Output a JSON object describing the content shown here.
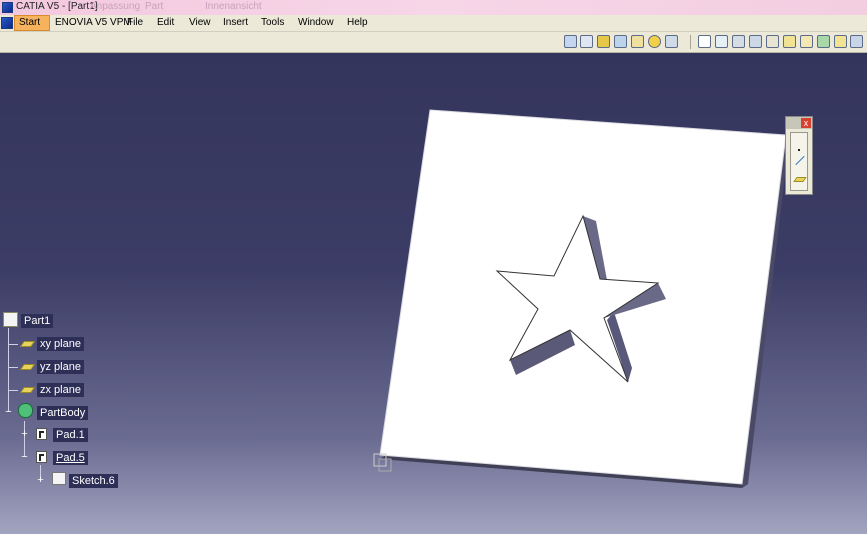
{
  "window": {
    "title": "CATIA V5 - [Part1]",
    "ghost_texts": [
      "Anpassung",
      "Part",
      "Innenansicht"
    ]
  },
  "menubar": {
    "start": "Start",
    "items": [
      "ENOVIA V5 VPM",
      "File",
      "Edit",
      "View",
      "Insert",
      "Tools",
      "Window",
      "Help"
    ]
  },
  "toolbar": {
    "icons": [
      "view-icon",
      "box-icon",
      "cube-icon",
      "rotate-icon",
      "pan-icon",
      "compass-icon",
      "zoom-icon",
      "sketch-tool-icon",
      "pad-tool-icon",
      "pocket-tool-icon",
      "shaft-tool-icon",
      "hole-tool-icon",
      "fillet-tool-icon",
      "chamfer-tool-icon",
      "draft-tool-icon",
      "shell-tool-icon",
      "thread-tool-icon"
    ]
  },
  "tree": {
    "part": "Part1",
    "xy": "xy plane",
    "yz": "yz plane",
    "zx": "zx plane",
    "body": "PartBody",
    "pad1": "Pad.1",
    "pad5": "Pad.5",
    "sketch": "Sketch.6"
  },
  "colors": {
    "background_top": "#34355c",
    "background_bottom": "#a3a4c0",
    "part_face": "#ffffff",
    "star_side": "#5a5a78"
  }
}
